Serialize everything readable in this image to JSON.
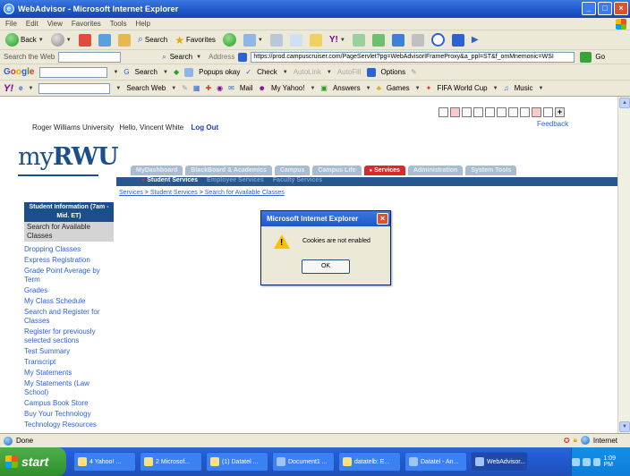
{
  "window": {
    "title": "WebAdvisor - Microsoft Internet Explorer",
    "menu": [
      "File",
      "Edit",
      "View",
      "Favorites",
      "Tools",
      "Help"
    ]
  },
  "toolbar": {
    "back": "Back",
    "search": "Search",
    "favorites": "Favorites"
  },
  "address": {
    "search_web_label": "Search the Web",
    "search_btn": "Search",
    "address_label": "Address",
    "url": "https://prod.campuscruiser.com/PageServlet?pg=WebAdvisorIFrameProxy&a_ppl=ST&f_omMnemonic=WSI",
    "go": "Go"
  },
  "google": {
    "logo_parts": [
      "G",
      "o",
      "o",
      "g",
      "l",
      "e"
    ],
    "search_btn": "Search",
    "popups": "Popups okay",
    "check": "Check",
    "autolink": "AutoLink",
    "autofill": "AutoFill",
    "options": "Options"
  },
  "yahoo": {
    "logo": "Y!",
    "search_web": "Search Web",
    "mail": "Mail",
    "my_yahoo": "My Yahoo!",
    "answers": "Answers",
    "games": "Games",
    "fifa": "FIFA World Cup",
    "music": "Music"
  },
  "page": {
    "university": "Roger Williams University",
    "greeting": "Hello, Vincent White",
    "logout": "Log Out",
    "feedback": "Feedback",
    "logo_my": "my",
    "logo_rwu": "RWU",
    "tabs": [
      "MyDashboard",
      "BlackBoard & Academics",
      "Campus",
      "Campus Life",
      "Services",
      "Administration",
      "System Tools"
    ],
    "subtabs": [
      "Student Services",
      "Employee Services",
      "Faculty Services"
    ],
    "breadcrumb": [
      "Services",
      "Student Services",
      "Search for Available Classes"
    ],
    "sidebar_header": "Student Information (7am - Mid. ET)",
    "sidebar_selected": "Search for Available Classes",
    "sidebar_items": [
      "Dropping Classes",
      "Express Registration",
      "Grade Point Average by Term",
      "Grades",
      "My Class Schedule",
      "Search and Register for Classes",
      "Register for previously selected sections",
      "Test Summary",
      "Transcript",
      "My Statements",
      "My Statements (Law School)",
      "Campus Book Store",
      "Buy Your Technology",
      "Technology Resources"
    ]
  },
  "dialog": {
    "title": "Microsoft Internet Explorer",
    "message": "Cookies are not enabled",
    "ok": "OK"
  },
  "status": {
    "left": "Done",
    "zone": "Internet"
  },
  "taskbar": {
    "start": "start",
    "tasks": [
      "4 Yahoo! ...",
      "2 Microsof...",
      "(1) Datatel ...",
      "Document1 ...",
      "datatelb: E...",
      "Datatel - An...",
      "WebAdvisor..."
    ],
    "clock": "1:09 PM"
  }
}
